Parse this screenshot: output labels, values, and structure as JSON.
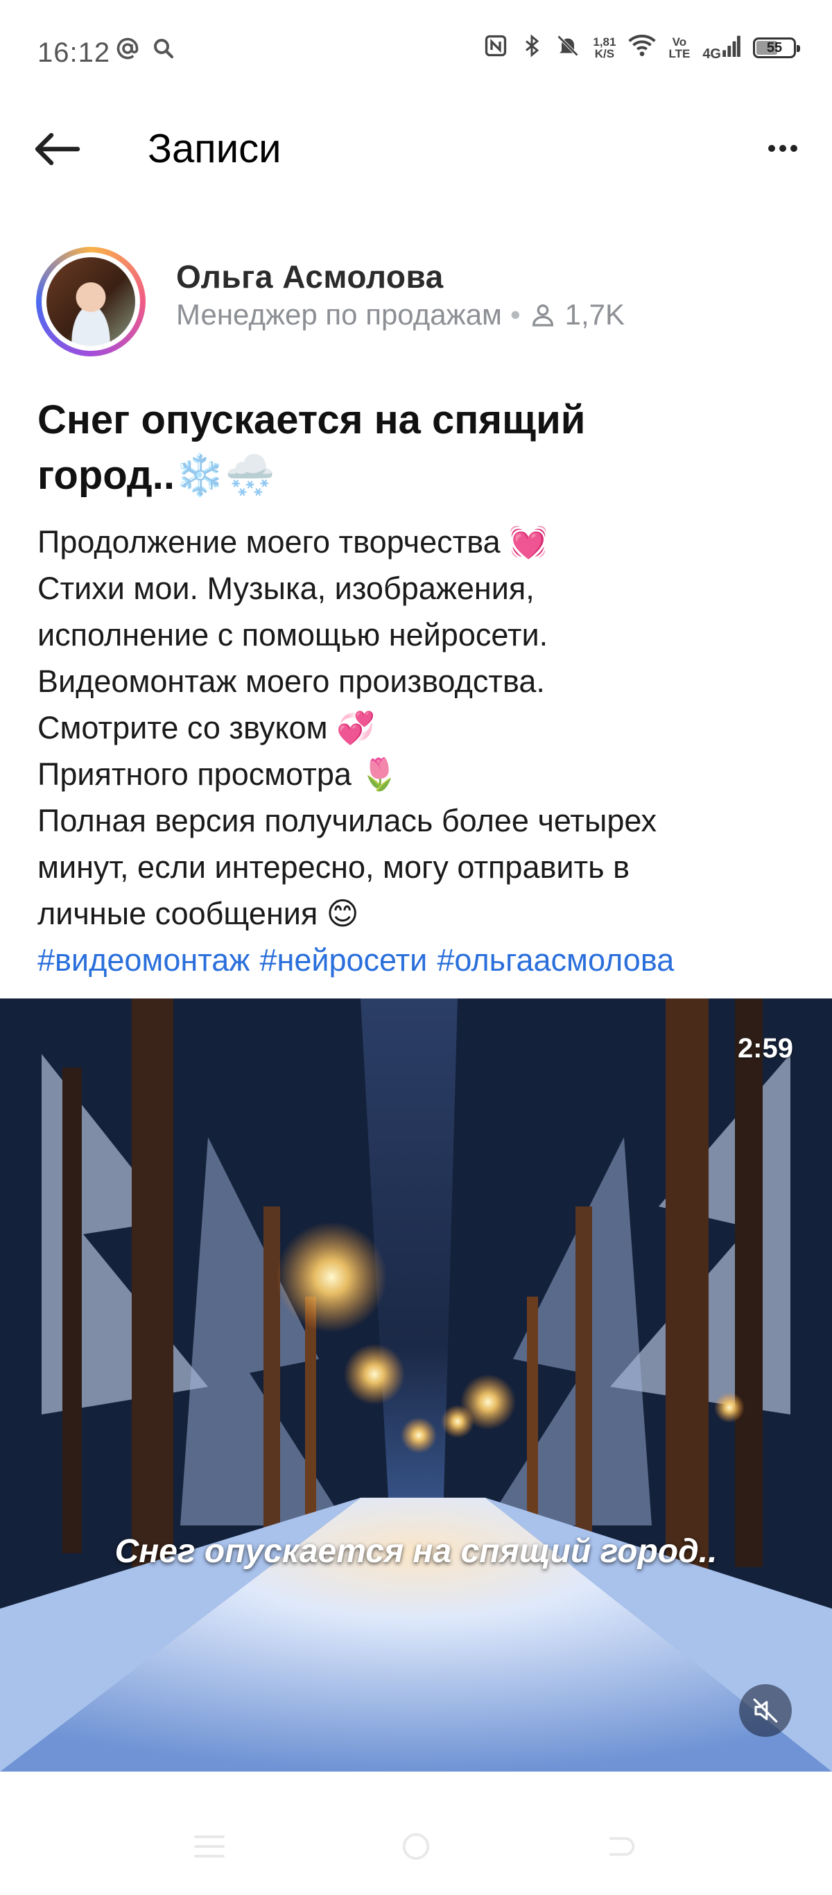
{
  "status_bar": {
    "time": "16:12",
    "speed_top": "1,81",
    "speed_bottom": "K/S",
    "volte_top": "Vo",
    "volte_bottom": "LTE",
    "network": "4G",
    "battery": "55"
  },
  "header": {
    "title": "Записи"
  },
  "author": {
    "name": "Ольга Асмолова",
    "role": "Менеджер по продажам",
    "followers": "1,7K"
  },
  "post": {
    "title_line1": "Снег опускается на спящий",
    "title_line2": "город..❄️🌨️",
    "lines": [
      "Продолжение моего творчества 💓",
      "Стихи мои. Музыка, изображения,",
      "исполнение с помощью нейросети.",
      "Видеомонтаж моего производства.",
      "Смотрите со звуком 💞",
      "Приятного просмотра 🌷",
      "Полная версия получилась более четырех",
      "минут, если интересно, могу отправить в",
      "личные сообщения 😊"
    ],
    "hashtags": [
      "#видеомонтаж",
      "#нейросети",
      "#ольгаасмолова"
    ]
  },
  "video": {
    "duration": "2:59",
    "caption": "Снег опускается на спящий город..",
    "muted": true
  },
  "icons": {
    "at": "at-icon",
    "search": "search-icon",
    "nfc": "nfc-icon",
    "bluetooth": "bluetooth-icon",
    "mute_bell": "bell-off-icon",
    "wifi": "wifi-icon",
    "signal": "signal-icon",
    "back": "arrow-left-icon",
    "more": "more-horizontal-icon",
    "followers": "person-icon",
    "sound_off": "volume-off-icon"
  },
  "colors": {
    "link": "#2a6fdb",
    "meta": "#8c8f94"
  }
}
